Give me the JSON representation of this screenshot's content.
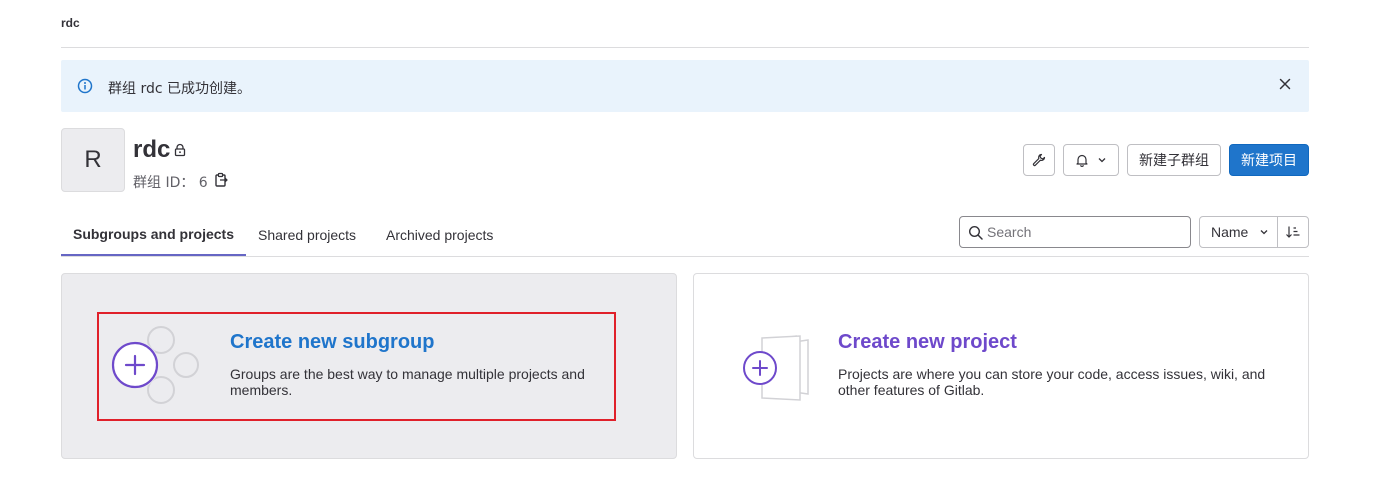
{
  "breadcrumb": {
    "current": "rdc"
  },
  "alert": {
    "message": "群组 rdc 已成功创建。"
  },
  "group": {
    "avatar_letter": "R",
    "name": "rdc",
    "id_label": "群组 ID： 6"
  },
  "header_actions": {
    "new_subgroup": "新建子群组",
    "new_project": "新建项目"
  },
  "tabs": [
    {
      "label": "Subgroups and projects",
      "active": true
    },
    {
      "label": "Shared projects",
      "active": false
    },
    {
      "label": "Archived projects",
      "active": false
    }
  ],
  "search": {
    "placeholder": "Search"
  },
  "sort": {
    "selected": "Name"
  },
  "cards": {
    "subgroup": {
      "title": "Create new subgroup",
      "description": "Groups are the best way to manage multiple projects and members."
    },
    "project": {
      "title": "Create new project",
      "description": "Projects are where you can store your code, access issues, wiki, and other features of Gitlab."
    }
  },
  "colors": {
    "primary": "#1f75cb",
    "purple": "#6e49cb",
    "alert_bg": "#e9f3fc",
    "highlight": "#e0202a",
    "tab_indicator": "#6666c4"
  },
  "icons": [
    "info-icon",
    "close-icon",
    "lock-icon",
    "copy-icon",
    "wrench-icon",
    "bell-icon",
    "chevron-down-icon",
    "search-icon",
    "sort-direction-icon",
    "plus-circle-icon"
  ]
}
